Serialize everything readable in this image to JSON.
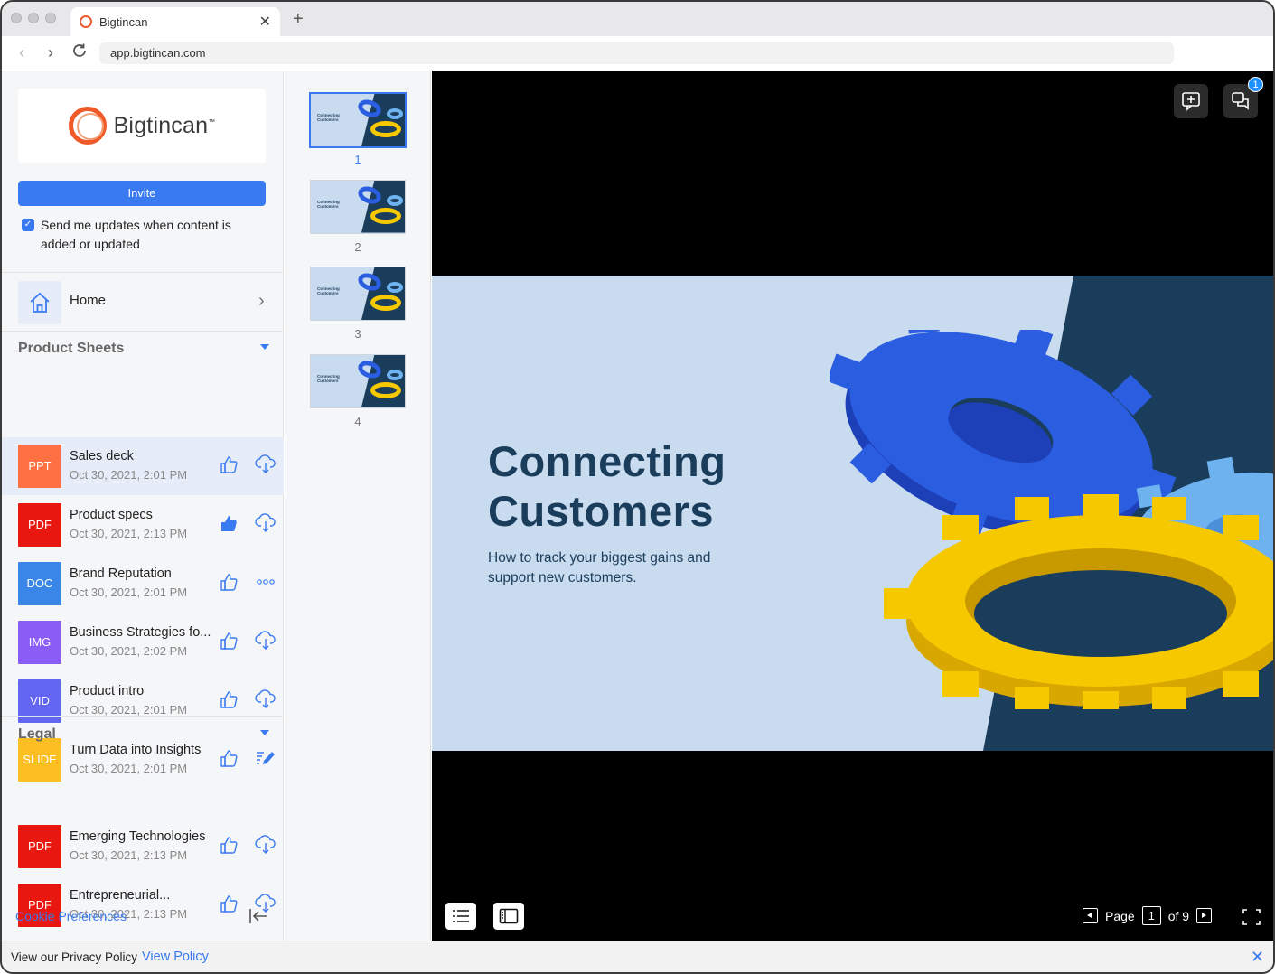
{
  "browser": {
    "tab_title": "Bigtincan",
    "new_tab": "+",
    "url": "app.bigtincan.com"
  },
  "sidebar": {
    "logo_text": "Bigtincan",
    "logo_tm": "™",
    "invite_label": "Invite",
    "updates_checked": true,
    "updates_label": "Send me updates when content is added or updated",
    "home_label": "Home",
    "sections": [
      {
        "title": "Product Sheets",
        "files": [
          {
            "type": "PPT",
            "color": "#ff7043",
            "name": "Sales deck",
            "date": "Oct 30, 2021, 2:01 PM",
            "liked": false,
            "action": "download"
          },
          {
            "type": "PDF",
            "color": "#e8170f",
            "name": "Product specs",
            "date": "Oct 30, 2021, 2:13 PM",
            "liked": true,
            "action": "download"
          },
          {
            "type": "DOC",
            "color": "#3a86e8",
            "name": "Brand Reputation",
            "date": "Oct 30, 2021, 2:01 PM",
            "liked": false,
            "action": "more"
          },
          {
            "type": "IMG",
            "color": "#8b5cf6",
            "name": "Business Strategies fo...",
            "date": "Oct 30, 2021, 2:02 PM",
            "liked": false,
            "action": "download"
          },
          {
            "type": "VID",
            "color": "#6366f1",
            "name": "Product intro",
            "date": "Oct 30, 2021, 2:01 PM",
            "liked": false,
            "action": "download"
          },
          {
            "type": "SLIDE",
            "color": "#fbbf24",
            "name": "Turn Data into Insights",
            "date": "Oct 30, 2021, 2:01 PM",
            "liked": false,
            "action": "edit"
          }
        ]
      },
      {
        "title": "Legal",
        "files": [
          {
            "type": "PDF",
            "color": "#e8170f",
            "name": "Emerging Technologies",
            "date": "Oct 30, 2021, 2:13 PM",
            "liked": false,
            "action": "download"
          },
          {
            "type": "PDF",
            "color": "#e8170f",
            "name": "Entrepreneurial...",
            "date": "Oct 30, 2021, 2:13 PM",
            "liked": false,
            "action": "download"
          }
        ]
      }
    ],
    "cookie_label": "Cookie Preferences"
  },
  "thumbnails": {
    "selected": 1,
    "items": [
      {
        "num": "1",
        "caption": "Connecting Customers"
      },
      {
        "num": "2",
        "caption": "Connecting Customers"
      },
      {
        "num": "3",
        "caption": "Connecting Customers"
      },
      {
        "num": "4",
        "caption": "Connecting Customers"
      }
    ]
  },
  "viewer": {
    "notification_count": "1",
    "slide_title_line1": "Connecting",
    "slide_title_line2": "Customers",
    "slide_subtitle": "How to track your biggest gains and support new customers.",
    "page_label": "Page",
    "page_current": "1",
    "page_total": "of 9"
  },
  "privacy": {
    "text": "View our Privacy Policy",
    "link": "View Policy"
  },
  "colors": {
    "accent": "#3a7af0",
    "slide_bg": "#c9dbee",
    "slide_dark": "#1a3d5c",
    "gear_blue": "#2a5de0",
    "gear_light": "#6fb2f0",
    "gear_yellow": "#f5c800"
  }
}
